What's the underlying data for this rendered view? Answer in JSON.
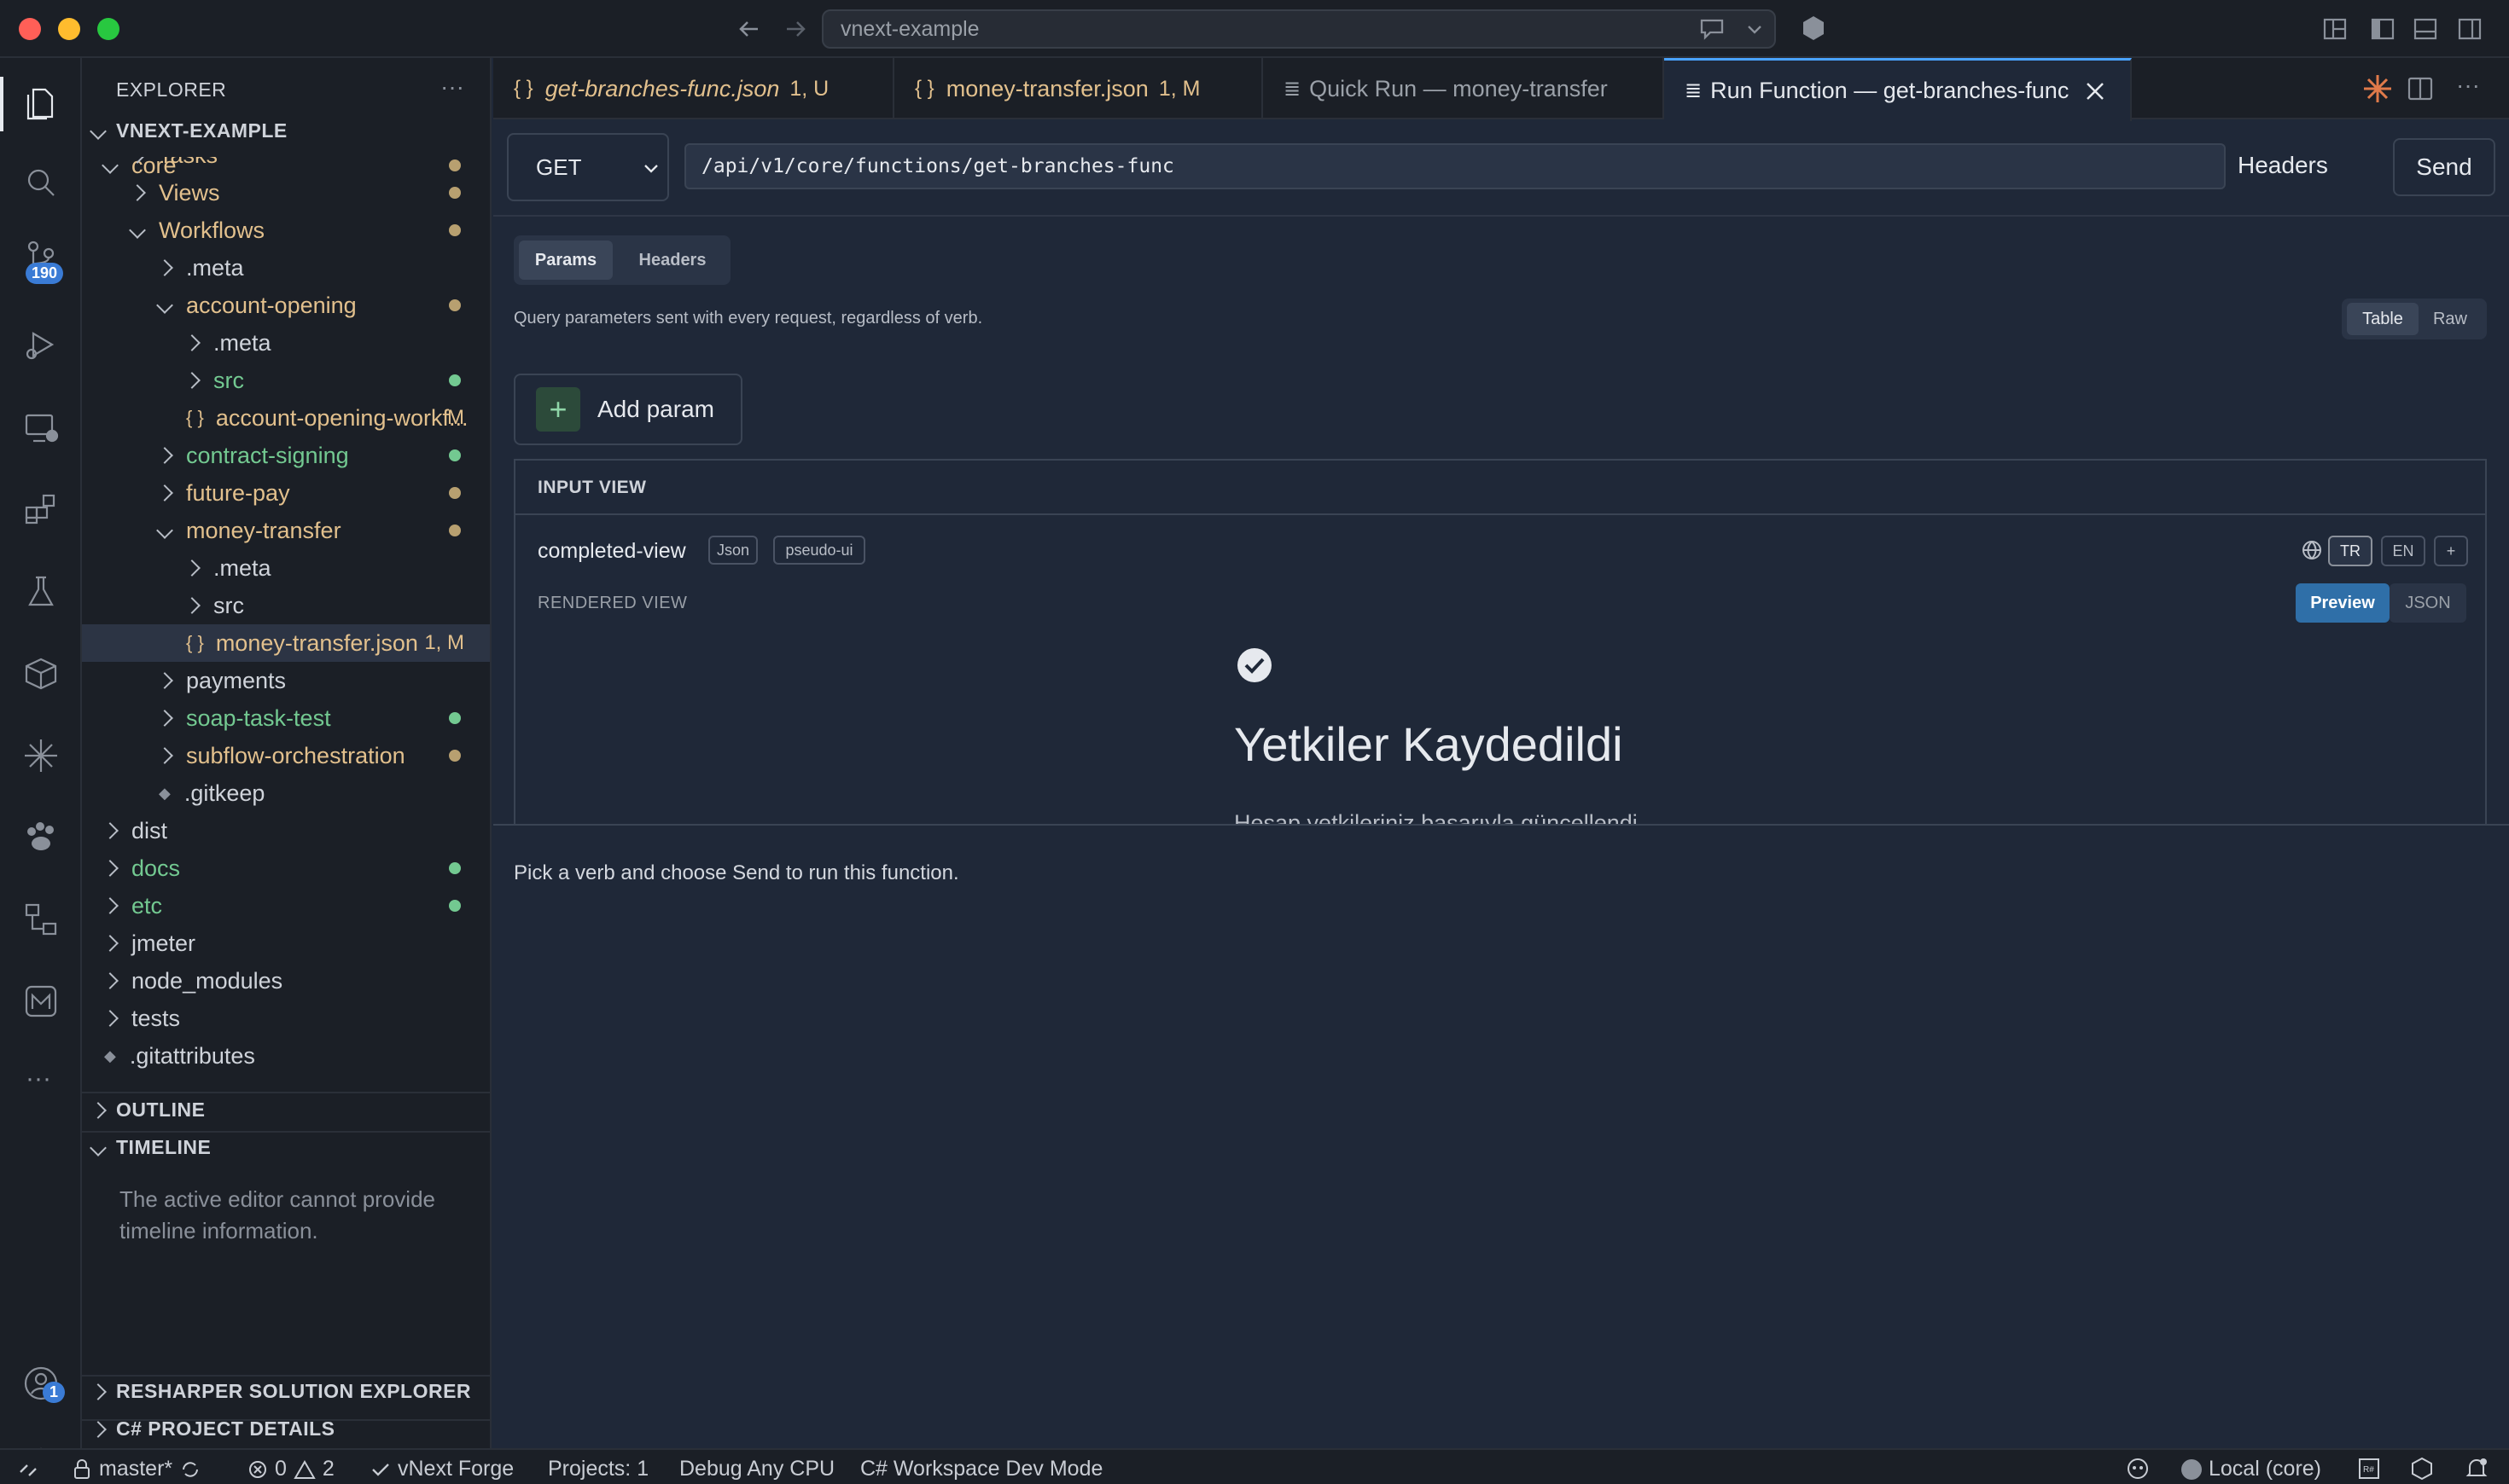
{
  "window": {
    "search": "vnext-example"
  },
  "activity_bar": {
    "scm_badge": "190",
    "account_badge": "1"
  },
  "sidebar": {
    "title": "EXPLORER",
    "root": "VNEXT-EXAMPLE",
    "tree": [
      {
        "label": "core",
        "color": "#e2c08d"
      },
      {
        "label": "Tasks",
        "color": "#e2c08d"
      },
      {
        "label": "Views",
        "color": "#e2c08d"
      },
      {
        "label": "Workflows",
        "color": "#e2c08d"
      },
      {
        "label": ".meta",
        "color": "#cfd3da"
      },
      {
        "label": "account-opening",
        "color": "#e2c08d"
      },
      {
        "label": ".meta",
        "color": "#cfd3da"
      },
      {
        "label": "src",
        "color": "#73c991"
      },
      {
        "label": "account-opening-workf...",
        "color": "#e2c08d",
        "status": "M"
      },
      {
        "label": "contract-signing",
        "color": "#73c991"
      },
      {
        "label": "future-pay",
        "color": "#e2c08d"
      },
      {
        "label": "money-transfer",
        "color": "#e2c08d"
      },
      {
        "label": ".meta",
        "color": "#cfd3da"
      },
      {
        "label": "src",
        "color": "#cfd3da"
      },
      {
        "label": "money-transfer.json",
        "color": "#e2c08d",
        "status": "1, M"
      },
      {
        "label": "payments",
        "color": "#cfd3da"
      },
      {
        "label": "soap-task-test",
        "color": "#73c991"
      },
      {
        "label": "subflow-orchestration",
        "color": "#e2c08d"
      },
      {
        "label": ".gitkeep",
        "color": "#cfd3da"
      },
      {
        "label": "dist",
        "color": "#cfd3da"
      },
      {
        "label": "docs",
        "color": "#73c991"
      },
      {
        "label": "etc",
        "color": "#73c991"
      },
      {
        "label": "jmeter",
        "color": "#cfd3da"
      },
      {
        "label": "node_modules",
        "color": "#cfd3da"
      },
      {
        "label": "tests",
        "color": "#cfd3da"
      },
      {
        "label": ".gitattributes",
        "color": "#cfd3da"
      }
    ],
    "outline": "OUTLINE",
    "timeline": "TIMELINE",
    "timeline_msg": "The active editor cannot provide timeline information.",
    "resharper": "RESHARPER SOLUTION EXPLORER",
    "csharp": "C# PROJECT DETAILS"
  },
  "tabs": [
    {
      "label": "get-branches-func.json",
      "status": "1, U"
    },
    {
      "label": "money-transfer.json",
      "status": "1, M"
    },
    {
      "label": "Quick Run — money-transfer",
      "status": ""
    },
    {
      "label": "Run Function — get-branches-func",
      "status": ""
    }
  ],
  "request": {
    "verb": "GET",
    "url": "/api/v1/core/functions/get-branches-func",
    "headers_btn": "Headers",
    "send_btn": "Send",
    "tab_params": "Params",
    "tab_headers": "Headers",
    "desc": "Query parameters sent with every request, regardless of verb.",
    "toggle_table": "Table",
    "toggle_raw": "Raw",
    "add_param": "Add param"
  },
  "input_view": {
    "header": "INPUT VIEW",
    "name": "completed-view",
    "tag_json": "Json",
    "tag_pseudo": "pseudo-ui",
    "lang_tr": "TR",
    "lang_en": "EN",
    "lang_add": "+",
    "rendered_label": "RENDERED VIEW",
    "preview": "Preview",
    "json": "JSON",
    "rendered_title": "Yetkiler Kaydedildi",
    "rendered_sub": "Hesap yetkileriniz başarıyla güncellendi."
  },
  "response_hint": "Pick a verb and choose Send to run this function.",
  "statusbar": {
    "branch": "master*",
    "errors": "0",
    "warnings": "2",
    "forge": "vNext Forge",
    "projects": "Projects: 1",
    "debug": "Debug Any CPU",
    "workspace": "C# Workspace Dev Mode",
    "env": "Local (core)"
  },
  "colors": {
    "accent": "#4aa3ff",
    "modified": "#e2c08d",
    "untracked": "#73c991"
  }
}
